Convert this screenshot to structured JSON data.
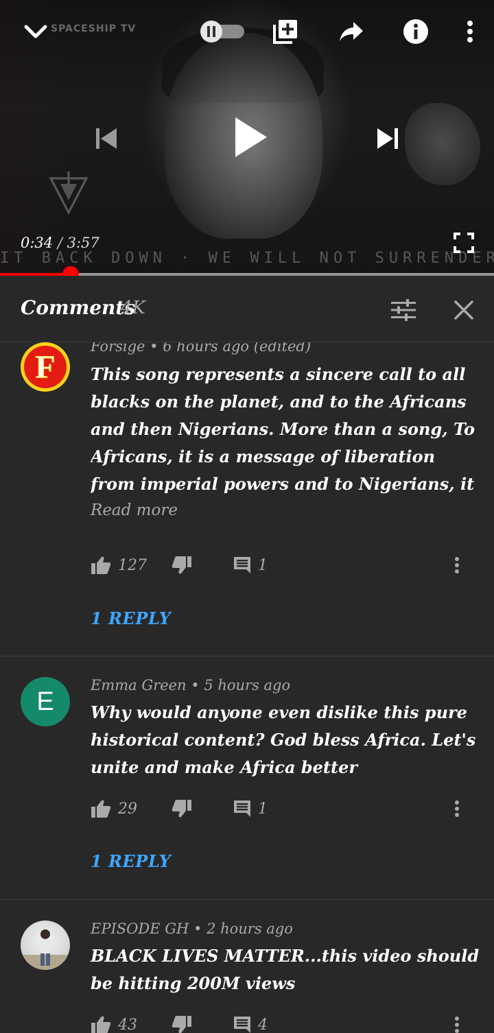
{
  "player": {
    "channel_watermark": "SPACESHIP TV",
    "banner_text": "IT BACK DOWN · WE WILL NOT SURRENDER. WE WILL NOT",
    "current_time": "0:34",
    "separator": "/",
    "duration": "3:57",
    "progress_fraction": 0.143,
    "icons": [
      "collapse-icon",
      "autoplay-toggle",
      "add-to-playlist-icon",
      "share-icon",
      "info-icon",
      "more-icon",
      "previous-icon",
      "play-icon",
      "next-icon",
      "fullscreen-icon"
    ],
    "accent": "#ff0000"
  },
  "comments_panel": {
    "title": "Comments",
    "count": "4K",
    "icons": [
      "sort-filter-icon",
      "close-icon"
    ]
  },
  "comments": [
    {
      "avatar_letter": "F",
      "author": "Forsige",
      "time": "6 hours ago",
      "edited": "(edited)",
      "text": "This song represents a sincere call to all blacks on the planet, and to the Africans and then Nigerians. More than a song, To Africans, it is a message of liberation from imperial powers and to Nigerians, it is calling on the younger generation to take a",
      "read_more": "Read more",
      "likes": "127",
      "replies_count": "1",
      "reply_link": "1 REPLY"
    },
    {
      "avatar_letter": "E",
      "author": "Emma Green",
      "time": "5 hours ago",
      "text": "Why would anyone even dislike this pure historical content?  God bless Africa. Let's unite and make Africa better",
      "likes": "29",
      "replies_count": "1",
      "reply_link": "1 REPLY"
    },
    {
      "author": "EPISODE GH",
      "time": "2 hours ago",
      "text": "BLACK LIVES MATTER...this video should be hitting 200M views",
      "likes": "43",
      "replies_count": "4"
    }
  ],
  "colors": {
    "background": "#282828",
    "link": "#3ea6ff",
    "muted": "#aaaaaa",
    "avatar_e": "#158a6b",
    "avatar_f_ring": "#ffd21a",
    "avatar_f_fill": "#e31b13"
  }
}
